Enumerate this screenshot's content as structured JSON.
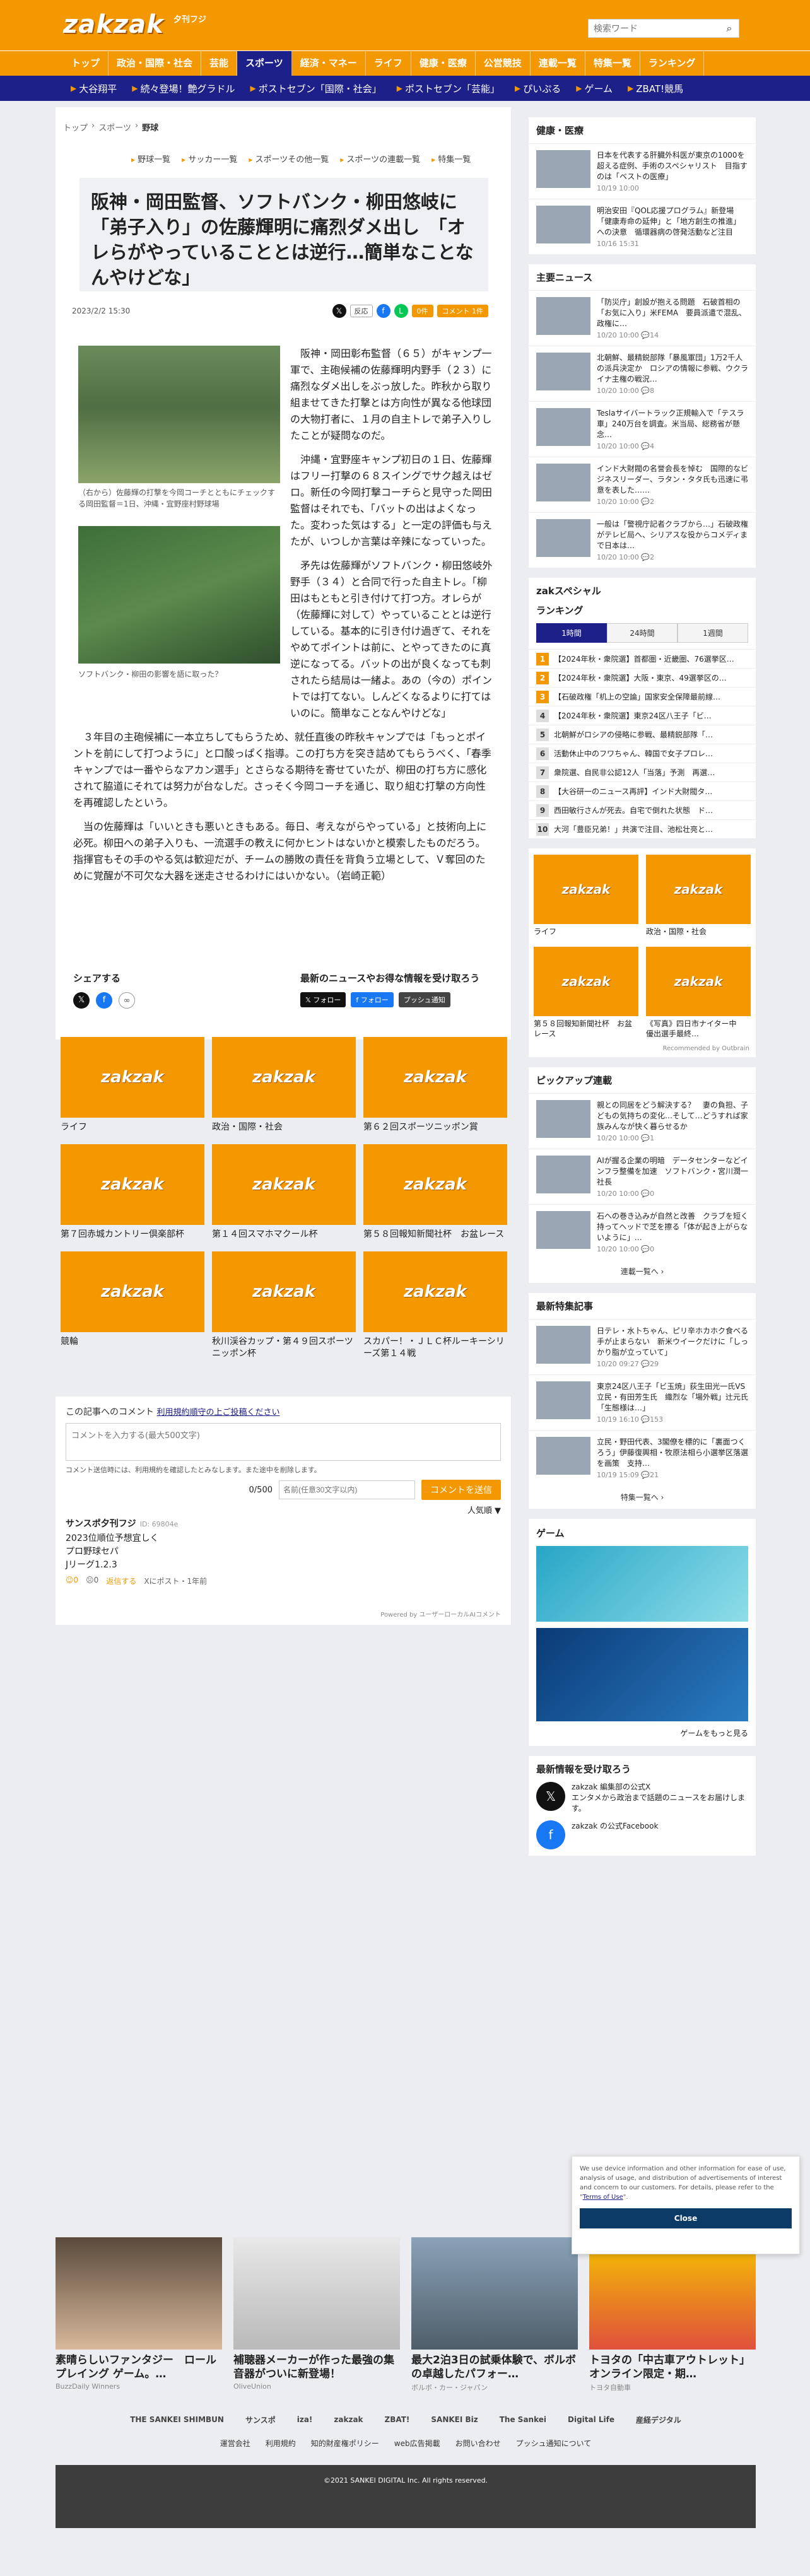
{
  "header": {
    "logo": "zakzak",
    "logo_sub": "夕刊フジ",
    "search_placeholder": "検索ワード"
  },
  "gnav": [
    "トップ",
    "政治・国際・社会",
    "芸能",
    "スポーツ",
    "経済・マネー",
    "ライフ",
    "健康・医療",
    "公営競技",
    "連載一覧",
    "特集一覧",
    "ランキング"
  ],
  "gnav_active": 3,
  "snav": [
    "大谷翔平",
    "続々登場！艶グラドル",
    "ポストセブン「国際・社会」",
    "ポストセブン「芸能」",
    "ぴいぷる",
    "ゲーム",
    "ZBAT!競馬"
  ],
  "breadcrumb": [
    "トップ",
    "スポーツ",
    "野球"
  ],
  "subnav": [
    "野球一覧",
    "サッカー一覧",
    "スポーツその他一覧",
    "スポーツの連載一覧",
    "特集一覧"
  ],
  "article": {
    "title": "阪神・岡田監督、ソフトバンク・柳田悠岐に「弟子入り」の佐藤輝明に痛烈ダメ出し　「オレらがやっていることとは逆行…簡単なことなんやけどな」",
    "date": "2023/2/2 15:30",
    "react": "反応",
    "btn_count": "0件",
    "btn_comment": "コメント 1件",
    "caption1": "（右から）佐藤輝の打撃を今岡コーチとともにチェックする岡田監督＝1日、沖縄・宜野座村野球場",
    "caption2": "ソフトバンク・柳田の影響を語に取った？",
    "p1": "阪神・岡田彰布監督（６５）がキャンプ一軍で、主砲候補の佐藤輝明内野手（２３）に痛烈なダメ出しをぶっ放した。昨秋から取り組ませてきた打撃とは方向性が異なる他球団の大物打者に、１月の自主トレで弟子入りしたことが疑問なのだ。",
    "p2": "沖縄・宜野座キャンプ初日の１日、佐藤輝はフリー打撃の６８スイングでサク越えはゼロ。新任の今岡打撃コーチらと見守った岡田監督はそれでも、「バットの出はよくなった。変わった気はする」と一定の評価も与えたが、いつしか言葉は辛辣になっていった。",
    "p3": "矛先は佐藤輝がソフトバンク・柳田悠岐外野手（３４）と合同で行った自主トレ。「柳田はもともと引き付けて打つ方。オレらが（佐藤輝に対して）やっていることとは逆行している。基本的に引き付け過ぎて、それをやめてポイントは前に、とやってきたのに真逆になってる。バットの出が良くなっても刺されたら結局は一緒よ。あの（今の）ポイントでは打てない。しんどくなるよりに打てはいのに。簡単なことなんやけどな」",
    "p4": "３年目の主砲候補に一本立ちしてもらうため、就任直後の昨秋キャンプでは「もっとポイントを前にして打つように」と口酸っぱく指導。この打ち方を突き詰めてもらうべく、「春季キャンプでは一番やらなアカン選手」とさらなる期待を寄せていたが、柳田の打ち方に感化されて脇道にそれては努力が台なしだ。さっそく今岡コーチを通じ、取り組む打撃の方向性を再確認したという。",
    "p5": "当の佐藤輝は「いいときも悪いときもある。毎日、考えながらやっている」と技術向上に必死。柳田への弟子入りも、一流選手の教えに何かヒントはないかと模索したものだろう。指揮官もその手のやる気は歓迎だが、チームの勝敗の責任を背負う立場として、Ｖ奪回のために覚醒が不可欠な大器を迷走させるわけにはいかない。（岩崎正範）",
    "share_title": "シェアする",
    "follow_title": "最新のニュースやお得な情報を受け取ろう",
    "follow_x": "フォロー",
    "follow_fb": "フォロー",
    "follow_push": "プッシュ通知"
  },
  "grid": [
    "ライフ",
    "政治・国際・社会",
    "第６２回スポーツニッポン賞",
    "第７回赤城カントリー倶楽部杯",
    "第１４回スマホマクール杯",
    "第５８回報知新聞社杯　お盆レース",
    "競輪",
    "秋川渓谷カップ・第４９回スポーツニッポン杯",
    "スカパー！・ＪＬＣ杯ルーキーシリーズ第１４戦"
  ],
  "grid_logo": "zakzak",
  "comments": {
    "prompt": "この記事へのコメント",
    "rules_link": "利用規約順守の上ご投稿ください",
    "textarea_placeholder": "コメントを入力する(最大500文字)",
    "note": "コメント送信時には、利用規約を確認したとみなします。また途中を削除します。",
    "counter": "0/500",
    "name_placeholder": "名前(任意30文字以内)",
    "send": "コメントを送信",
    "sort": "人気順 ▼",
    "user": "サンスポ夕刊フジ",
    "user_id": "ID: 69804e",
    "text1": "2023位順位予想宜しく",
    "text2": "プロ野球セパ",
    "text3": "Jリーグ1.2.3",
    "likes": "0",
    "dislikes": "0",
    "reply": "返信する",
    "from": "Xにポスト・1年前",
    "powered": "Powered by ユーザーローカルAIコメント"
  },
  "side": {
    "health_title": "健康・医療",
    "health": [
      {
        "t": "日本を代表する肝臓外科医が東京の1000を超える症例、手術のスペシャリスト　目指すのは「ベストの医療」",
        "d": "10/19 10:00"
      },
      {
        "t": "明治安田『QOL応援プログラム』新登場　「健康寿命の延伸」と「地方創生の推進」への決意　循環器病の啓発活動など注目",
        "d": "10/16 15:31"
      }
    ],
    "main_title": "主要ニュース",
    "main": [
      {
        "t": "「防災庁」創設が抱える問題　石破首相の「お気に入り」米FEMA　要員派遣で混乱、政権に…",
        "d": "10/20 10:00",
        "c": "14"
      },
      {
        "t": "北朝鮮、最精鋭部隊「暴風軍団」1万2千人の派兵決定か　ロシアの情報に参戦、ウクライナ主権の戦況…",
        "d": "10/20 10:00",
        "c": "8"
      },
      {
        "t": "Teslaサイバートラック正規輸入で「テスラ車」240万台を調査。米当局、総務省が懸念…",
        "d": "10/20 10:00",
        "c": "4"
      },
      {
        "t": "インド大財閥の名誉会長を悼む　国際的なビジネスリーダー、ラタン・タタ氏も迅速に弔意を表した……",
        "d": "10/20 10:00",
        "c": "2"
      },
      {
        "t": "一般は「警視庁記者クラブから…」石破政権がテレビ局へ、シリアスな役からコメディまで日本は…",
        "d": "10/20 10:00",
        "c": "2"
      }
    ],
    "special_title": "zakスペシャル",
    "rank_title": "ランキング",
    "rank_tabs": [
      "1時間",
      "24時間",
      "1週間"
    ],
    "rank": [
      "【2024年秋・衆院選】首都圏・近畿圏、76選挙区…",
      "【2024年秋・衆院選】大阪・東京、49選挙区の…",
      "【石破政権「机上の空論」国家安全保障最前線…",
      "【2024年秋・衆院選】東京24区八王子「ビ…",
      "北朝鮮がロシアの侵略に参戦、最精鋭部隊「…",
      "活動休止中のフワちゃん、韓国で女子プロレ…",
      "衆院選、自民非公認12人「当落」予測　再選…",
      "【大谷研一のニュース再評】インド大財閥タ…",
      "西田敏行さんが死去。自宅で倒れた状態　ド…",
      "大河「豊臣兄弟！」共演で注目、池松壮亮と…"
    ],
    "sgrid": [
      {
        "l": "ライフ"
      },
      {
        "l": "政治・国際・社会"
      },
      {
        "l": "第５８回報知新聞社杯　お盆レース"
      },
      {
        "l": "《写真》四日市ナイター中　優出選手最終…"
      }
    ],
    "pickup_title": "ピックアップ連載",
    "pickup": [
      {
        "t": "親との同居をどう解決する？　妻の負担、子どもの気持ちの変化…そして…どうすれば家族みんなが快く暮らせるか",
        "d": "10/20 10:00",
        "c": "1"
      },
      {
        "t": "AIが握る企業の明暗　データセンターなどインフラ整備を加速　ソフトバンク・宮川潤一社長",
        "d": "10/20 10:00",
        "c": "0"
      },
      {
        "t": "石への巻き込みが自然と改善　クラブを短く持ってヘッドで芝を擦る「体が起き上がらないように」…",
        "d": "10/20 10:00",
        "c": "0"
      }
    ],
    "pickup_more": "連載一覧へ ›",
    "feature_title": "最新特集記事",
    "feature": [
      {
        "t": "日テレ・水卜ちゃん、ピリ辛ホカホク食べる手が止まらない　新米ウイークだけに「しっかり脂が立っていて」",
        "d": "10/20 09:27",
        "c": "29"
      },
      {
        "t": "東京24区八王子「ビ玉焼」荻生田光一氏VS立民・有田芳生氏　織烈な「場外戦」辻元氏「生態様は…」",
        "d": "10/19 16:10",
        "c": "153"
      },
      {
        "t": "立民・野田代表、3閣僚を標的に「裏面つくろう」伊藤復興相・牧原法相ら小選挙区落選を画策　支持…",
        "d": "10/19 15:09",
        "c": "21"
      }
    ],
    "feature_more": "特集一覧へ ›",
    "game_title": "ゲーム",
    "game_more": "ゲームをもっと見る",
    "news_title": "最新情報を受け取ろう",
    "news_x_name": "zakzak 編集部の公式X",
    "news_x_desc": "エンタメから政治まで話題のニュースをお届けします。",
    "news_fb_name": "zakzak の公式Facebook"
  },
  "ads": [
    {
      "t": "素晴らしいファンタジー　ロールプレイング ゲーム。…",
      "s": "BuzzDaily Winners"
    },
    {
      "t": "補聴器メーカーが作った最強の集音器がついに新登場！",
      "s": "OliveUnion"
    },
    {
      "t": "最大2泊3日の試乗体験で、ボルボの卓越したパフォー…",
      "s": "ボルボ・カー・ジャパン"
    },
    {
      "t": "トヨタの「中古車アウトレット」オンライン限定・期…",
      "s": "トヨタ自動車"
    }
  ],
  "outbrain": "Recommended by Outbrain",
  "cookie": {
    "text": "We use device information and other information for ease of use, analysis of usage, and distribution of advertisements of interest and concern to our customers. For details, please refer to the",
    "link": "Terms of Use",
    "close": "Close"
  },
  "logos": [
    "THE SANKEI SHIMBUN",
    "サンスポ",
    "iza!",
    "zakzak",
    "ZBAT!",
    "SANKEI Biz",
    "The Sankei",
    "Digital Life",
    "産経デジタル"
  ],
  "footer_links": [
    "運営会社",
    "利用規約",
    "知的財産権ポリシー",
    "web広告掲載",
    "お問い合わせ",
    "プッシュ通知について"
  ],
  "copyright": "©2021 SANKEI DIGITAL Inc. All rights reserved.",
  "colors": {
    "brand": "#f39800",
    "navy": "#1d2088"
  }
}
